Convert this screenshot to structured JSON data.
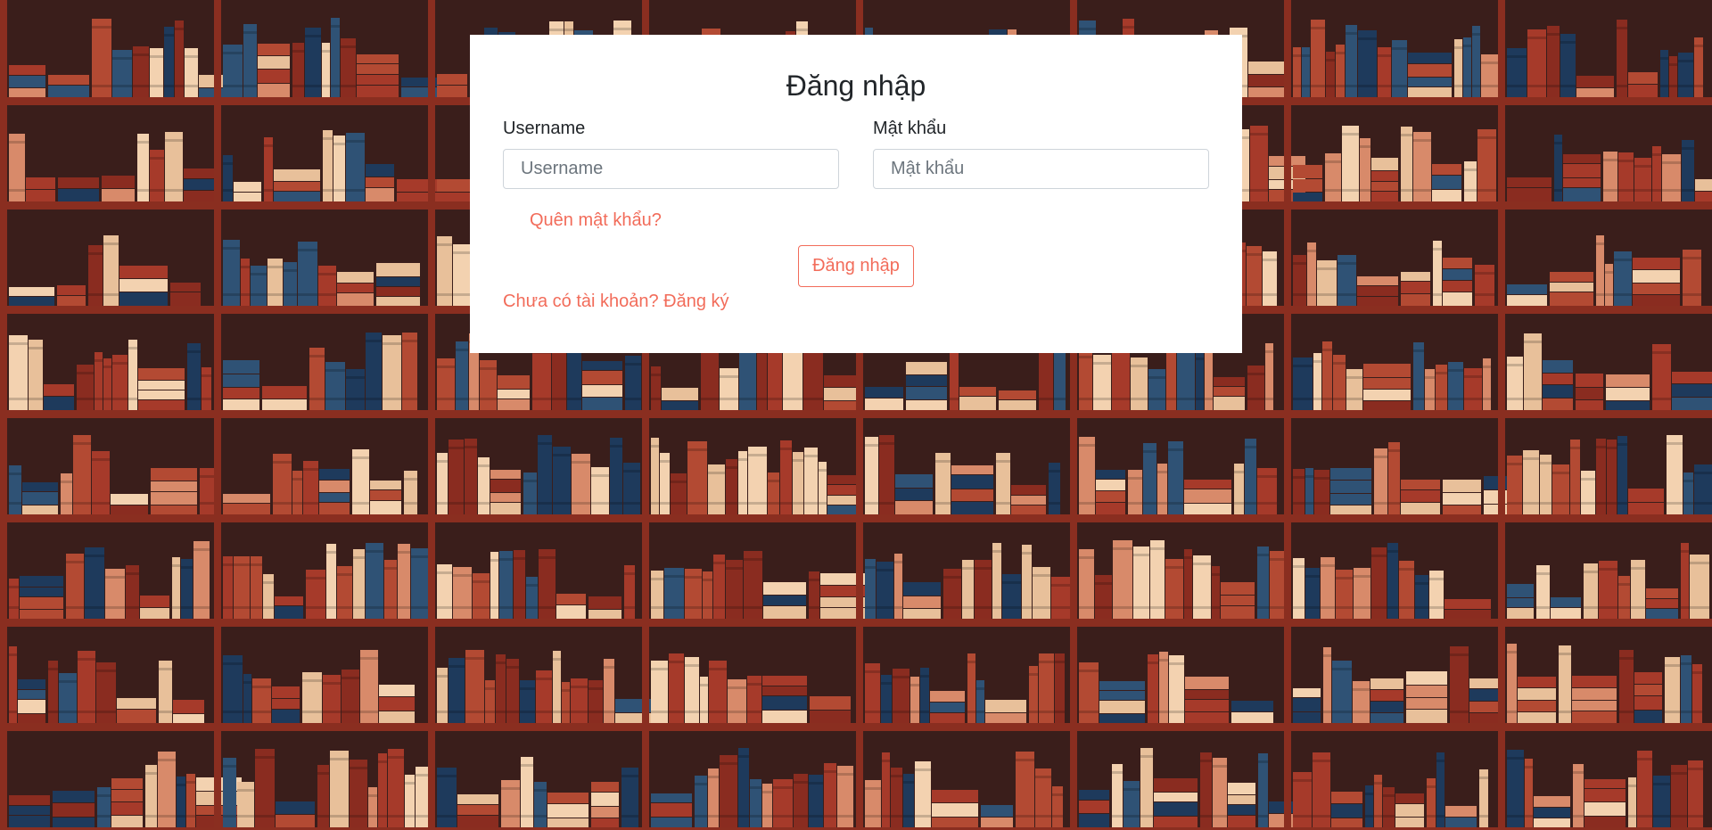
{
  "login": {
    "title": "Đăng nhập",
    "username_label": "Username",
    "username_placeholder": "Username",
    "username_value": "",
    "password_label": "Mật khẩu",
    "password_placeholder": "Mật khẩu",
    "password_value": "",
    "forgot_link": "Quên mật khẩu?",
    "submit_label": "Đăng nhập",
    "register_link": "Chưa có tài khoản? Đăng ký"
  },
  "theme": {
    "accent": "#f26c5a",
    "card_background": "#ffffff",
    "text_color": "#212529",
    "background_motif": "bookshelf-pattern",
    "shelf_wood": "#8a2e20",
    "shelf_back": "#3a1e1b",
    "book_colors": [
      "#b34a33",
      "#8a2c20",
      "#1e3a5c",
      "#2f5275",
      "#f3d2b0",
      "#e8c09a",
      "#a63a2a",
      "#d88a6a"
    ]
  }
}
